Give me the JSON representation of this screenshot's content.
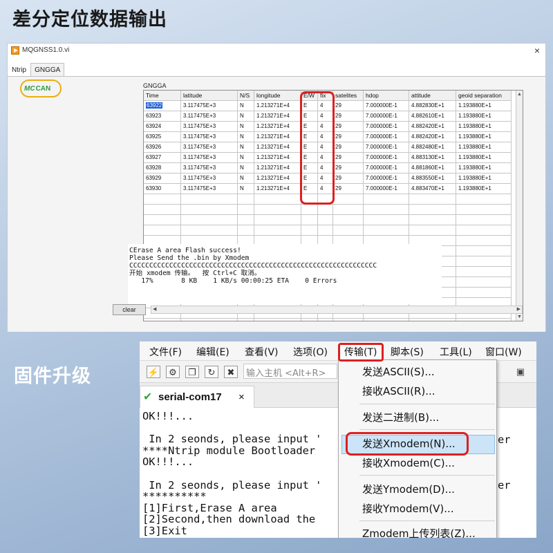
{
  "heading_top": "差分定位数据输出",
  "heading_bottom": "固件升级",
  "colors": {
    "highlight_red": "#dc2020",
    "selection_blue": "#1a5ad6",
    "hover_blue": "#cce4f7"
  },
  "top_window": {
    "title": "MQGNSS1.0.vi",
    "close_glyph": "×",
    "tabs": [
      "Ntrip",
      "GNGGA"
    ],
    "active_tab": "GNGGA",
    "logo": {
      "part1": "MC",
      "part2": "CAN"
    },
    "grid_label": "GNGGA",
    "columns": [
      "Time",
      "latitude",
      "N/S",
      "longitude",
      "E/W",
      "fix",
      "satelites",
      "hdop",
      "attitude",
      "geoid separation"
    ],
    "rows": [
      [
        "63922",
        "3.117475E+3",
        "N",
        "1.213271E+4",
        "E",
        "4",
        "29",
        "7.000000E-1",
        "4.882830E+1",
        "1.193880E+1"
      ],
      [
        "63923",
        "3.117475E+3",
        "N",
        "1.213271E+4",
        "E",
        "4",
        "29",
        "7.000000E-1",
        "4.882610E+1",
        "1.193880E+1"
      ],
      [
        "63924",
        "3.117475E+3",
        "N",
        "1.213271E+4",
        "E",
        "4",
        "29",
        "7.000000E-1",
        "4.882420E+1",
        "1.193880E+1"
      ],
      [
        "63925",
        "3.117475E+3",
        "N",
        "1.213271E+4",
        "E",
        "4",
        "29",
        "7.000000E-1",
        "4.882420E+1",
        "1.193880E+1"
      ],
      [
        "63926",
        "3.117475E+3",
        "N",
        "1.213271E+4",
        "E",
        "4",
        "29",
        "7.000000E-1",
        "4.882480E+1",
        "1.193880E+1"
      ],
      [
        "63927",
        "3.117475E+3",
        "N",
        "1.213271E+4",
        "E",
        "4",
        "29",
        "7.000000E-1",
        "4.883130E+1",
        "1.193880E+1"
      ],
      [
        "63928",
        "3.117475E+3",
        "N",
        "1.213271E+4",
        "E",
        "4",
        "29",
        "7.000000E-1",
        "4.881860E+1",
        "1.193880E+1"
      ],
      [
        "63929",
        "3.117475E+3",
        "N",
        "1.213271E+4",
        "E",
        "4",
        "29",
        "7.000000E-1",
        "4.883550E+1",
        "1.193880E+1"
      ],
      [
        "63930",
        "3.117475E+3",
        "N",
        "1.213271E+4",
        "E",
        "4",
        "29",
        "7.000000E-1",
        "4.883470E+1",
        "1.193880E+1"
      ]
    ],
    "console_lines": [
      "CErase A area Flash success!",
      "Please Send the .bin by Xmodem",
      "CCCCCCCCCCCCCCCCCCCCCCCCCCCCCCCCCCCCCCCCCCCCCCCCCCCCCCCCCCCCCC",
      "开始 xmodem 传输。  按 Ctrl+C 取消。",
      "   17%       8 KB    1 KB/s 00:00:25 ETA    0 Errors"
    ],
    "clear_label": "clear"
  },
  "bottom_window": {
    "menu": [
      "文件(F)",
      "编辑(E)",
      "查看(V)",
      "选项(O)",
      "传输(T)",
      "脚本(S)",
      "工具(L)",
      "窗口(W)"
    ],
    "host_placeholder": "输入主机 <Alt+R>",
    "session_tab": "serial-com17",
    "session_close": "×",
    "terminal_lines": [
      "OK!!!...",
      "",
      " In 2 seonds, please input '",
      "****Ntrip module Bootloader",
      "OK!!!...",
      "",
      " In 2 seonds, please input '",
      "**********",
      "[1]First,Erase A area",
      "[2]Second,then download the",
      "[3]Exit"
    ],
    "terminal_peek": [
      "er",
      "er"
    ],
    "transfer_menu": [
      "发送ASCII(S)...",
      "接收ASCII(R)...",
      "发送二进制(B)...",
      "发送Xmodem(N)...",
      "接收Xmodem(C)...",
      "发送Ymodem(D)...",
      "接收Ymodem(V)...",
      "Zmodem上传列表(Z)..."
    ]
  }
}
